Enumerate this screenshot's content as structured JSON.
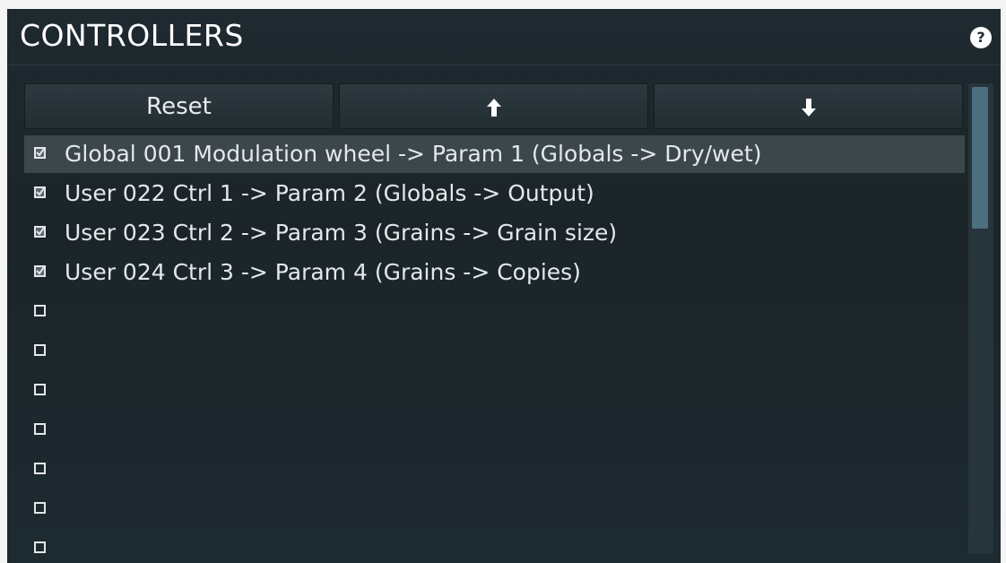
{
  "header": {
    "title": "CONTROLLERS",
    "help_label": "?"
  },
  "toolbar": {
    "reset_label": "Reset",
    "up_icon": "arrow-up-icon",
    "down_icon": "arrow-down-icon"
  },
  "controllers": {
    "selected_index": 0,
    "items": [
      {
        "label": "Global 001 Modulation wheel -> Param 1 (Globals -> Dry/wet)",
        "checked": true
      },
      {
        "label": "User 022 Ctrl 1 -> Param 2 (Globals -> Output)",
        "checked": true
      },
      {
        "label": "User 023 Ctrl 2 -> Param 3 (Grains -> Grain size)",
        "checked": true
      },
      {
        "label": "User 024 Ctrl 3 -> Param 4 (Grains -> Copies)",
        "checked": true
      },
      {
        "label": "",
        "checked": false
      },
      {
        "label": "",
        "checked": false
      },
      {
        "label": "",
        "checked": false
      },
      {
        "label": "",
        "checked": false
      },
      {
        "label": "",
        "checked": false
      },
      {
        "label": "",
        "checked": false
      },
      {
        "label": "",
        "checked": false
      }
    ]
  },
  "colors": {
    "panel_bg": "#1e2a30",
    "selected_row_bg": "#3c474c",
    "scrollbar_thumb": "#4d6e7e",
    "text": "#e4e8ea"
  }
}
